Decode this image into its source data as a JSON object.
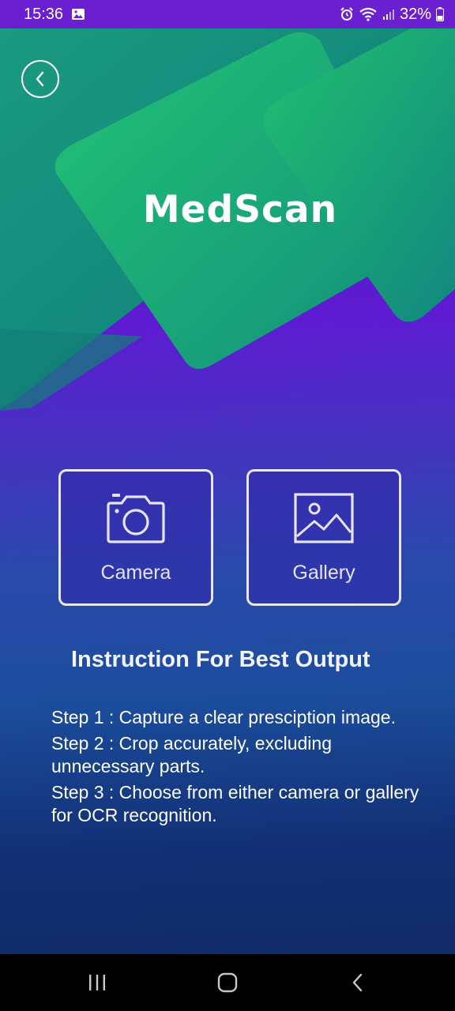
{
  "status_bar": {
    "time": "15:36",
    "battery": "32%",
    "icons": [
      "gallery-notification-icon",
      "alarm-icon",
      "wifi-icon",
      "signal-icon",
      "battery-icon"
    ]
  },
  "header": {
    "title": "MedScan",
    "back_icon": "chevron-left-icon"
  },
  "actions": [
    {
      "label": "Camera",
      "icon": "camera-icon"
    },
    {
      "label": "Gallery",
      "icon": "image-icon"
    }
  ],
  "instructions": {
    "title": "Instruction For Best Output",
    "steps": [
      "Step 1 : Capture  a clear presciption image.",
      "Step 2 : Crop accurately, excluding unnecessary parts.",
      "Step 3 : Choose from either camera or gallery for OCR recognition."
    ]
  },
  "nav_bar": {
    "buttons": [
      "recent-apps-icon",
      "home-icon",
      "back-icon"
    ]
  },
  "colors": {
    "status_bar": "#6a1fd0",
    "accent_green": "#1fb873",
    "teal": "#14887f",
    "purple": "#5e1cd2",
    "navy": "#0f2a66"
  }
}
